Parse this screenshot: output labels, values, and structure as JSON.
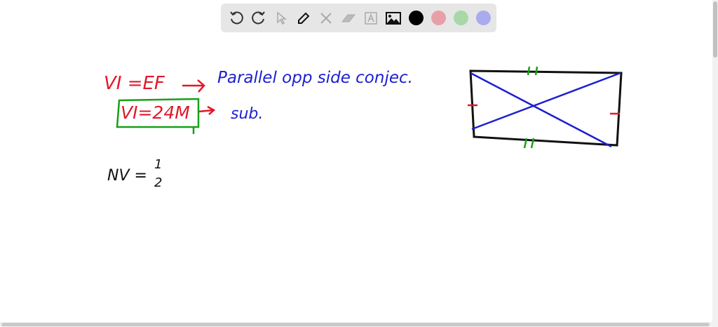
{
  "toolbar": {
    "tools": [
      "undo",
      "redo",
      "select",
      "pen",
      "tools",
      "eraser",
      "text",
      "image"
    ],
    "colors": {
      "black": "#000000",
      "red": "#e8a0a8",
      "green": "#a8d8a8",
      "purple": "#aaaaee"
    }
  },
  "board": {
    "line1_left": "VI =EF",
    "line1_right": "Parallel opp side conjec.",
    "line2_boxed": "VI=24M",
    "line2_right": "sub.",
    "line3_left": "NV =",
    "line3_num": "1",
    "line3_den": "2"
  }
}
